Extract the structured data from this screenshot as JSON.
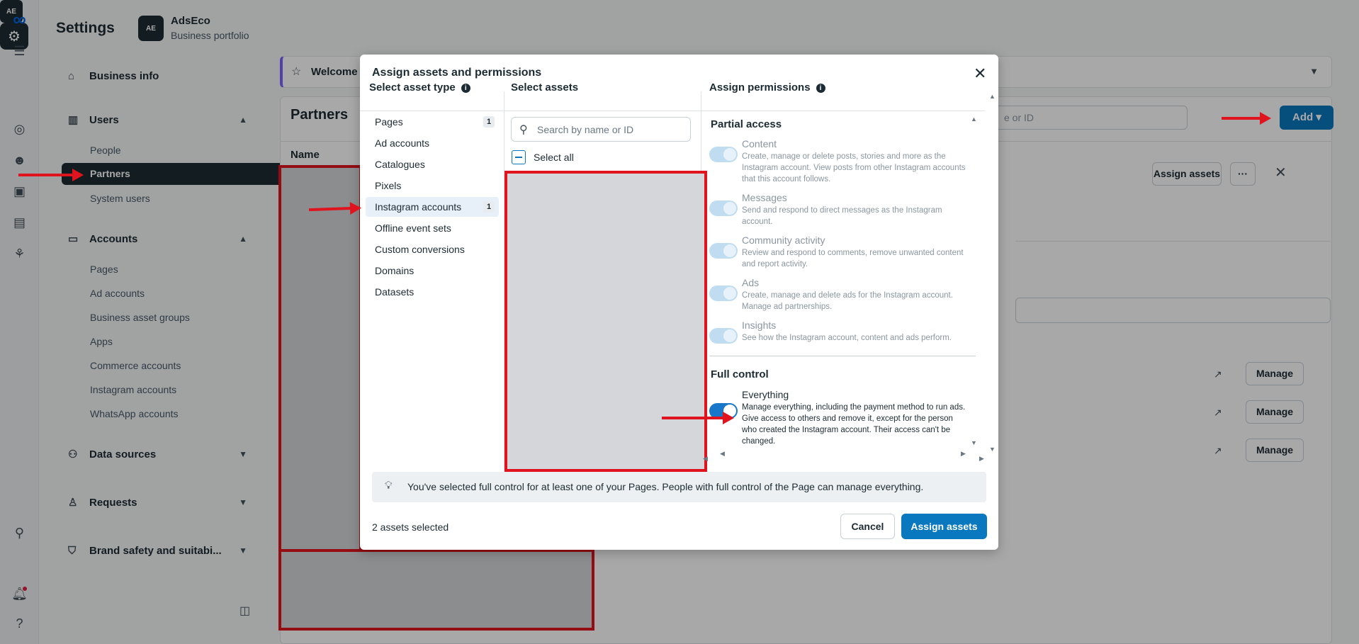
{
  "sidebar": {
    "title": "Settings",
    "business_name": "AdsEco",
    "business_sub": "Business portfolio",
    "logo_text": "AE",
    "business_info": "Business info",
    "users": "Users",
    "users_items": [
      "People",
      "Partners",
      "System users"
    ],
    "accounts": "Accounts",
    "accounts_items": [
      "Pages",
      "Ad accounts",
      "Business asset groups",
      "Apps",
      "Commerce accounts",
      "Instagram accounts",
      "WhatsApp accounts"
    ],
    "data_sources": "Data sources",
    "requests": "Requests",
    "brand_safety": "Brand safety and suitabi..."
  },
  "main": {
    "welcome": "Welcome t",
    "title": "Partners",
    "search_placeholder": "e or ID",
    "add_label": "Add",
    "name_header": "Name",
    "assign_assets": "Assign assets",
    "more": "···",
    "manage": "Manage"
  },
  "modal": {
    "title": "Assign assets and permissions",
    "col1_header": "Select asset type",
    "col2_header": "Select assets",
    "col3_header": "Assign permissions",
    "asset_types": [
      {
        "label": "Pages",
        "count": "1"
      },
      {
        "label": "Ad accounts",
        "count": ""
      },
      {
        "label": "Catalogues",
        "count": ""
      },
      {
        "label": "Pixels",
        "count": ""
      },
      {
        "label": "Instagram accounts",
        "count": "1"
      },
      {
        "label": "Offline event sets",
        "count": ""
      },
      {
        "label": "Custom conversions",
        "count": ""
      },
      {
        "label": "Domains",
        "count": ""
      },
      {
        "label": "Datasets",
        "count": ""
      }
    ],
    "search_placeholder": "Search by name or ID",
    "select_all": "Select all",
    "partial_access": "Partial access",
    "permissions": [
      {
        "name": "Content",
        "desc": "Create, manage or delete posts, stories and more as the Instagram account. View posts from other Instagram accounts that this account follows."
      },
      {
        "name": "Messages",
        "desc": "Send and respond to direct messages as the Instagram account."
      },
      {
        "name": "Community activity",
        "desc": "Review and respond to comments, remove unwanted content and report activity."
      },
      {
        "name": "Ads",
        "desc": "Create, manage and delete ads for the Instagram account. Manage ad partnerships."
      },
      {
        "name": "Insights",
        "desc": "See how the Instagram account, content and ads perform."
      }
    ],
    "full_control": "Full control",
    "everything": "Everything",
    "everything_desc": "Manage everything, including the payment method to run ads. Give access to others and remove it, except for the person who created the Instagram account. Their access can't be changed.",
    "notice": "You've selected full control for at least one of your Pages. People with full control of the Page can manage everything.",
    "selected_count": "2 assets selected",
    "cancel": "Cancel",
    "assign": "Assign assets"
  }
}
